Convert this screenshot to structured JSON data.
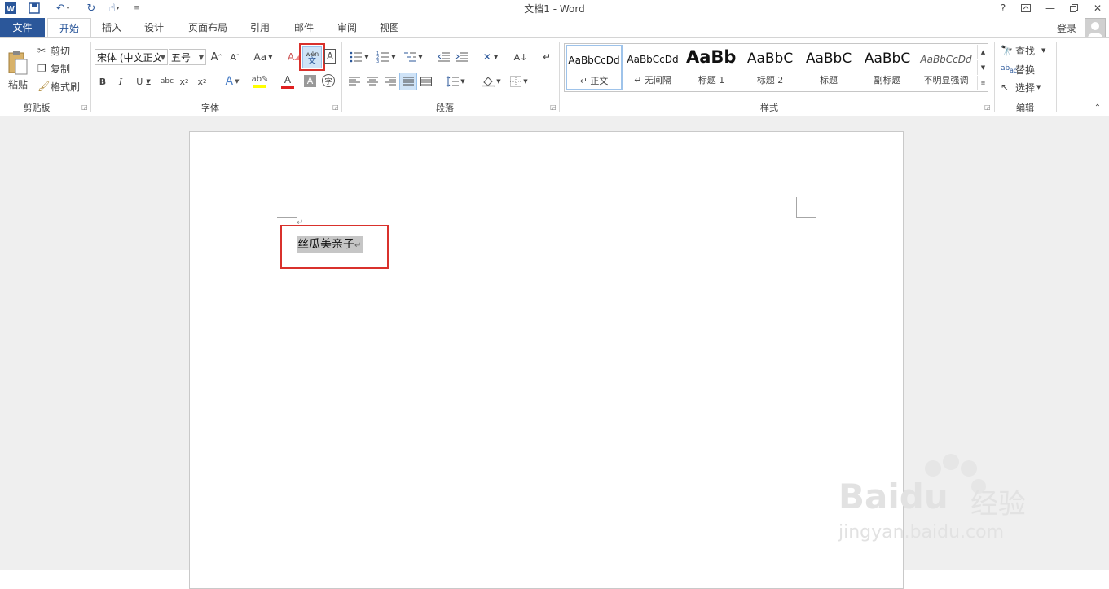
{
  "window": {
    "title": "文档1 - Word",
    "help": "?",
    "login": "登录"
  },
  "tabs": [
    {
      "label": "文件"
    },
    {
      "label": "开始"
    },
    {
      "label": "插入"
    },
    {
      "label": "设计"
    },
    {
      "label": "页面布局"
    },
    {
      "label": "引用"
    },
    {
      "label": "邮件"
    },
    {
      "label": "审阅"
    },
    {
      "label": "视图"
    }
  ],
  "clipboard": {
    "paste": "粘贴",
    "cut": "剪切",
    "copy": "复制",
    "format_painter": "格式刷",
    "group": "剪贴板"
  },
  "font": {
    "name": "宋体 (中文正文)",
    "size": "五号",
    "case_label": "Aa",
    "phonetic_top": "wén",
    "phonetic_bottom": "文",
    "group": "字体"
  },
  "paragraph": {
    "group": "段落"
  },
  "styles": {
    "items": [
      {
        "sample": "AaBbCcDd",
        "name": "↵ 正文"
      },
      {
        "sample": "AaBbCcDd",
        "name": "↵ 无间隔"
      },
      {
        "sample": "AaBb",
        "name": "标题 1"
      },
      {
        "sample": "AaBbC",
        "name": "标题 2"
      },
      {
        "sample": "AaBbC",
        "name": "标题"
      },
      {
        "sample": "AaBbC",
        "name": "副标题"
      },
      {
        "sample": "AaBbCcDd",
        "name": "不明显强调"
      }
    ],
    "group": "样式"
  },
  "editing": {
    "find": "查找",
    "replace": "替换",
    "select": "选择",
    "group": "编辑"
  },
  "document": {
    "selected_text": "丝瓜美亲子",
    "para_mark": "↵"
  },
  "watermark": {
    "brand": "Baidu",
    "brand_cn": "经验",
    "url": "jingyan.baidu.com"
  },
  "colors": {
    "accent": "#2b579a",
    "highlight_box": "#d9312c",
    "selection": "#c6c6c6"
  }
}
